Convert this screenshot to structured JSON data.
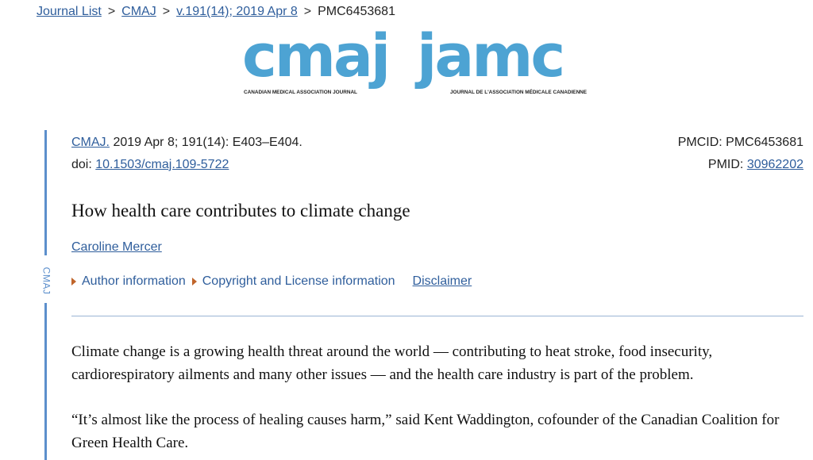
{
  "breadcrumb": {
    "items": [
      "Journal List",
      "CMAJ",
      "v.191(14); 2019 Apr 8",
      "PMC6453681"
    ],
    "separator": ">"
  },
  "logo": {
    "left_word": "cmaj",
    "right_word": "jamc",
    "left_caption": "CANADIAN MEDICAL ASSOCIATION JOURNAL",
    "right_caption": "JOURNAL DE L'ASSOCIATION MÉDICALE CANADIENNE",
    "color": "#4da3d3"
  },
  "side_label": "CMAJ",
  "citation": {
    "journal_link": "CMAJ.",
    "details": " 2019 Apr 8; 191(14): E403–E404.",
    "doi_label": "doi: ",
    "doi_link": "10.1503/cmaj.109-5722",
    "pmcid": "PMCID: PMC6453681",
    "pmid_label": "PMID: ",
    "pmid_link": "30962202"
  },
  "article": {
    "title": "How health care contributes to climate change",
    "author": "Caroline Mercer"
  },
  "info_links": {
    "author_info": "Author information",
    "copyright": "Copyright and License information",
    "disclaimer": "Disclaimer"
  },
  "body": {
    "paragraphs": [
      "Climate change is a growing health threat around the world — contributing to heat stroke, food insecurity, cardiorespiratory ailments and many other issues — and the health care industry is part of the problem.",
      "“It’s almost like the process of healing causes harm,” said Kent Waddington, cofounder of the Canadian Coalition for Green Health Care."
    ]
  },
  "colors": {
    "link": "#2f5e9c",
    "accent_bar": "#5c8fcc",
    "triangle": "#c0652b",
    "logo": "#4da3d3"
  }
}
